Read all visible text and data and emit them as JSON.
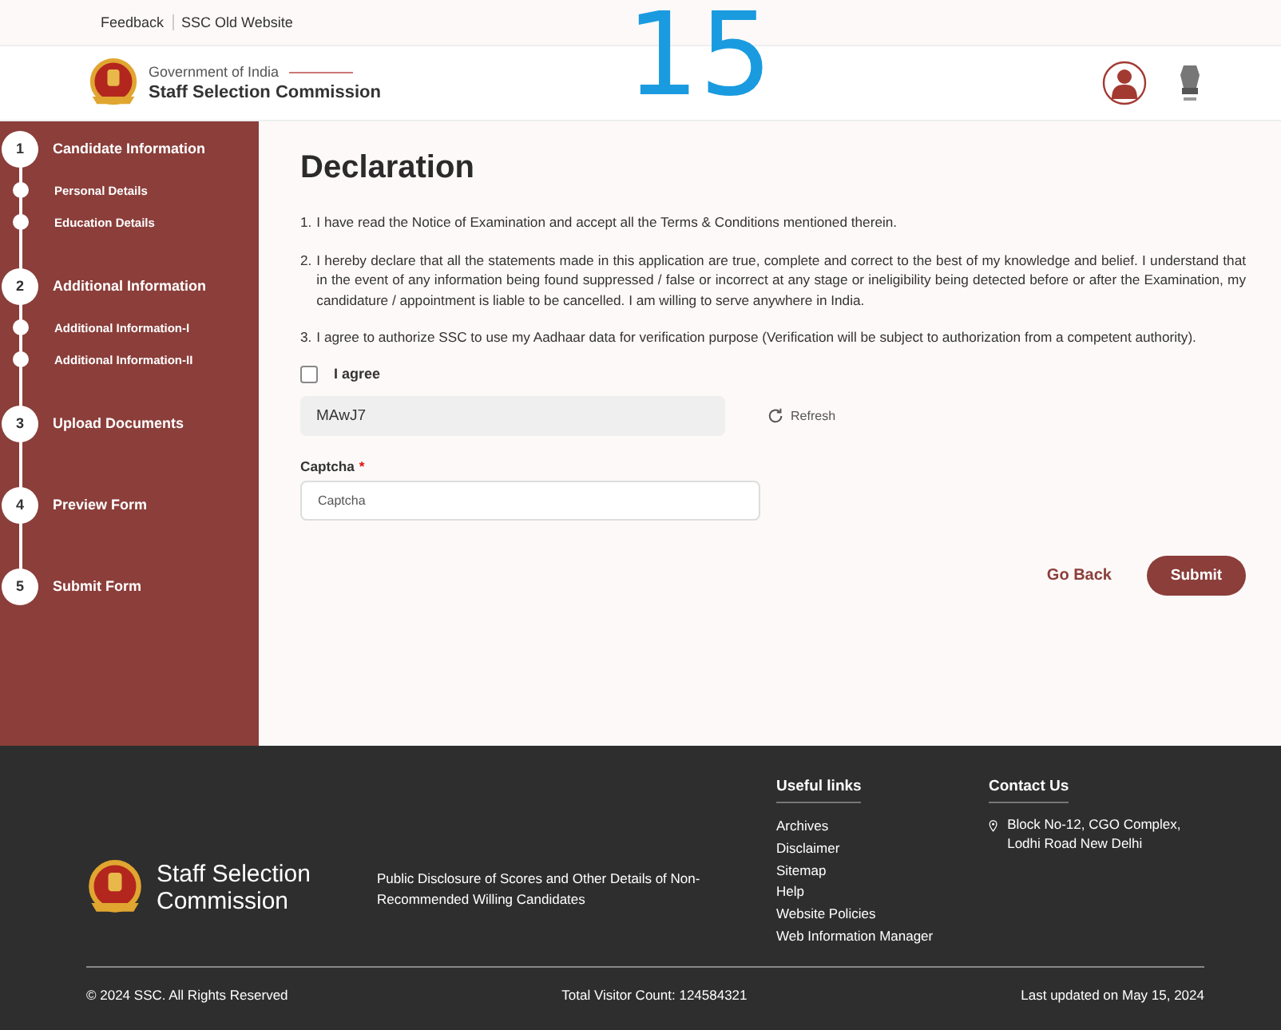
{
  "overlay_number": "15",
  "top_links": [
    {
      "label": "Feedback"
    },
    {
      "label": "SSC Old Website"
    }
  ],
  "header": {
    "subtitle": "Government of India",
    "title": "Staff Selection Commission"
  },
  "steps": [
    {
      "number": "1",
      "label": "Candidate Information",
      "children": [
        {
          "label": "Personal Details"
        },
        {
          "label": "Education Details"
        }
      ]
    },
    {
      "number": "2",
      "label": "Additional Information",
      "children": [
        {
          "label": "Additional Information-I"
        },
        {
          "label": "Additional Information-II"
        }
      ]
    },
    {
      "number": "3",
      "label": "Upload Documents"
    },
    {
      "number": "4",
      "label": "Preview Form"
    },
    {
      "number": "5",
      "label": "Submit Form"
    }
  ],
  "declaration": {
    "title": "Declaration",
    "items": [
      {
        "number": "1.",
        "text": "I have read the Notice of Examination and accept all the Terms & Conditions mentioned therein."
      },
      {
        "number": "2.",
        "text": "I hereby declare that all the statements made in this application are true, complete and correct to the best of my knowledge and belief. I understand that in the event of any information being found suppressed / false or incorrect at any stage or ineligibility being detected before or after the Examination, my candidature / appointment is liable to be cancelled. I am willing to serve anywhere in India."
      },
      {
        "number": "3.",
        "text": "I agree to authorize SSC to use my Aadhaar data for verification purpose (Verification will be subject to authorization from a competent authority)."
      }
    ],
    "agree": {
      "label": "I agree",
      "checked": false
    },
    "captcha_code": "MAwJ7",
    "refresh": "Refresh",
    "captcha_field": {
      "label": "Captcha",
      "required_mark": "*",
      "placeholder": "Captcha"
    },
    "buttons": {
      "back": "Go Back",
      "submit": "Submit"
    }
  },
  "footer": {
    "title": "Staff Selection Commission",
    "disclosure": "Public Disclosure of Scores and Other  Details of Non-Recommended Willing Candidates",
    "useful_links": {
      "heading": "Useful links",
      "items": [
        "Archives",
        "Disclaimer",
        "Sitemap",
        "Help",
        "Website Policies",
        "Web Information Manager"
      ]
    },
    "contact": {
      "heading": "Contact Us",
      "address": "Block No-12, CGO Complex, Lodhi Road New Delhi"
    },
    "copyright": "© 2024 SSC. All Rights Reserved",
    "visitor_count": "Total Visitor  Count: 124584321",
    "last_updated": "Last updated on May 15, 2024"
  }
}
